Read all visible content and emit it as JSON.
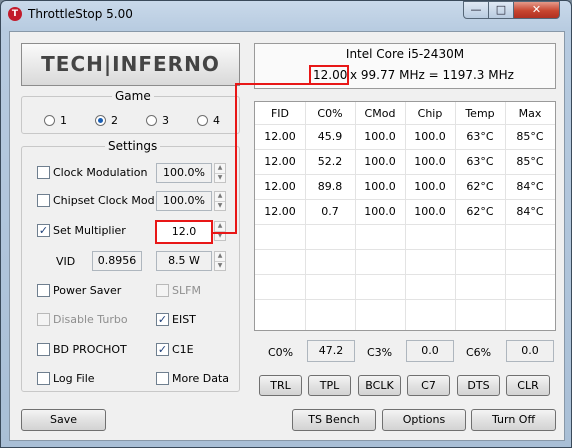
{
  "window": {
    "title": "ThrottleStop 5.00",
    "minimize": "—",
    "maximize": "□",
    "close": "✕",
    "app_icon_letter": "T"
  },
  "logo": {
    "text": "TECH|INFERNO"
  },
  "game": {
    "label": "Game",
    "options": [
      "1",
      "2",
      "3",
      "4"
    ],
    "selected": "2"
  },
  "settings": {
    "label": "Settings",
    "clock_modulation": {
      "label": "Clock Modulation",
      "checked": false,
      "value": "100.0%"
    },
    "chipset_clock_mod": {
      "label": "Chipset Clock Mod",
      "checked": false,
      "value": "100.0%"
    },
    "set_multiplier": {
      "label": "Set Multiplier",
      "checked": true,
      "value": "12.0"
    },
    "vid": {
      "label": "VID",
      "value": "0.8956",
      "watts": "8.5 W"
    },
    "power_saver": {
      "label": "Power Saver",
      "checked": false
    },
    "slfm": {
      "label": "SLFM",
      "checked": false,
      "disabled": true
    },
    "disable_turbo": {
      "label": "Disable Turbo",
      "checked": false,
      "disabled": true
    },
    "eist": {
      "label": "EIST",
      "checked": true
    },
    "bd_prochot": {
      "label": "BD PROCHOT",
      "checked": false
    },
    "c1e": {
      "label": "C1E",
      "checked": true
    },
    "log_file": {
      "label": "Log File",
      "checked": false
    },
    "more_data": {
      "label": "More Data",
      "checked": false
    }
  },
  "cpu": {
    "name": "Intel Core i5-2430M",
    "multiplier": "12.00",
    "freq_rest": "x 99.77 MHz = 1197.3 MHz"
  },
  "table": {
    "headers": [
      "FID",
      "C0%",
      "CMod",
      "Chip",
      "Temp",
      "Max"
    ],
    "rows": [
      [
        "12.00",
        "45.9",
        "100.0",
        "100.0",
        "63°C",
        "85°C"
      ],
      [
        "12.00",
        "52.2",
        "100.0",
        "100.0",
        "63°C",
        "85°C"
      ],
      [
        "12.00",
        "89.8",
        "100.0",
        "100.0",
        "62°C",
        "84°C"
      ],
      [
        "12.00",
        "0.7",
        "100.0",
        "100.0",
        "62°C",
        "84°C"
      ]
    ]
  },
  "cstates": {
    "c0_label": "C0%",
    "c0": "47.2",
    "c3_label": "C3%",
    "c3": "0.0",
    "c6_label": "C6%",
    "c6": "0.0"
  },
  "buttons": {
    "trl": "TRL",
    "tpl": "TPL",
    "bclk": "BCLK",
    "c7": "C7",
    "dts": "DTS",
    "clr": "CLR",
    "save": "Save",
    "ts_bench": "TS Bench",
    "options": "Options",
    "turn_off": "Turn Off"
  },
  "colors": {
    "highlight": "#e81717",
    "title_gradient": "#b7cbe0",
    "close_button": "#c7452f"
  }
}
